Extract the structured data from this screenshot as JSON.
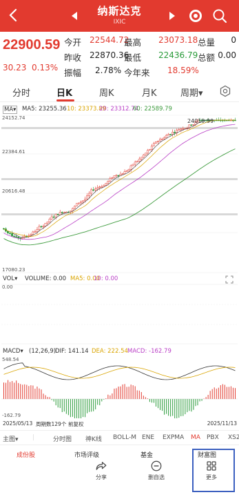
{
  "header": {
    "title": "纳斯达克",
    "subtitle": "IXIC"
  },
  "quote": {
    "price": "22900.59",
    "change": "30.23",
    "change_pct": "0.13%",
    "rows": [
      {
        "l1": "今开",
        "v1": "22544.72",
        "l2": "最高",
        "v2": "23073.18",
        "l3": "总量",
        "v3": "0"
      },
      {
        "l1": "昨收",
        "v1": "22870.36",
        "l2": "最低",
        "v2": "22436.79",
        "l3": "总额",
        "v3": "0.00"
      },
      {
        "l1": "振幅",
        "v1": "2.78%",
        "l2": "今年来",
        "v2": "18.59%"
      }
    ]
  },
  "tabs": [
    "分时",
    "日K",
    "周K",
    "月K",
    "周期▾"
  ],
  "main_chart": {
    "ma_label": "MA",
    "ma5": "MA5: 23255.36",
    "ma10": "10: 23373.89",
    "ma20": "20: 23312.74",
    "ma60": "60: 22589.79",
    "ticks": [
      "24152.74",
      "22384.61",
      "20616.48",
      "17080.23"
    ],
    "high_mark": "24019.99"
  },
  "vol_chart": {
    "label": "VOL",
    "volume": "VOLUME: 0.00",
    "ma5": "MA5: 0.00",
    "ma10": "10: 0.00",
    "tick": "0.00"
  },
  "macd_chart": {
    "label": "MACD",
    "params": "(12,26,9)",
    "dif": "DIF: 141.14",
    "dea": "DEA: 222.54",
    "macd": "MACD: -162.79",
    "top_tick": "548.54",
    "bottom_tick": "-162.79",
    "date_start": "2025/05/13",
    "period": "周期数129个",
    "adjust": "前复权",
    "date_end": "2025/11/13"
  },
  "strip": [
    "主图▾",
    "分时图",
    "神K线",
    "BOLL-M",
    "ENE",
    "EXPMA",
    "MA",
    "PBX",
    "XS2"
  ],
  "tabbar": {
    "partial_labels": [
      "成份股",
      "市场评级",
      "基金"
    ],
    "share": "分享",
    "remove": "删自选",
    "extra_top": "财富图",
    "more": "更多"
  },
  "colors": {
    "brand": "#e23a2f",
    "down": "#2a9b3a",
    "ma5": "#333333",
    "ma10": "#d9a400",
    "ma20": "#b93ec6",
    "ma60": "#3d9b3d",
    "highlight": "#3b5fbf"
  }
}
